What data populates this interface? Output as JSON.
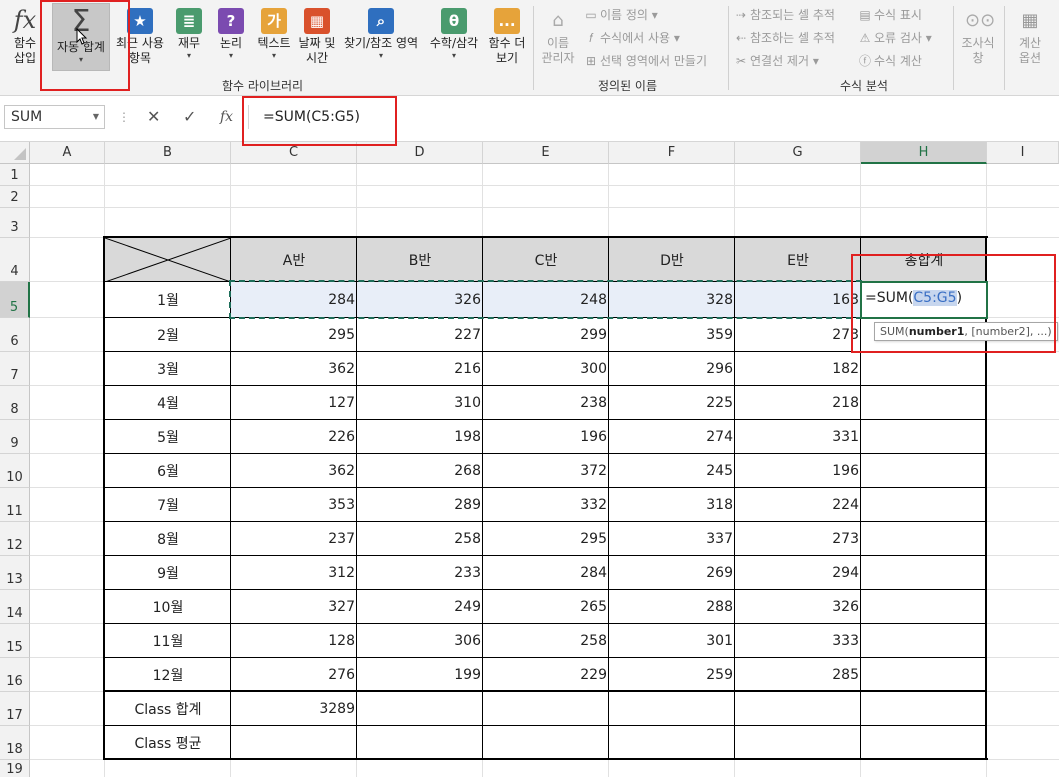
{
  "ribbon": {
    "insert_function": {
      "icon": "fx",
      "label1": "함수",
      "label2": "삽입"
    },
    "autosum": {
      "icon": "Σ",
      "label": "자동 합계",
      "arrow": "▾"
    },
    "recent": {
      "label1": "최근 사용",
      "label2": "항목",
      "arrow": "▾"
    },
    "financial": {
      "label": "재무",
      "arrow": "▾"
    },
    "logical": {
      "icon": "?",
      "label": "논리",
      "arrow": "▾"
    },
    "text": {
      "icon": "가",
      "label": "텍스트",
      "arrow": "▾"
    },
    "datetime": {
      "label1": "날짜 및",
      "label2": "시간",
      "arrow": "▾"
    },
    "lookup": {
      "label": "찾기/참조 영역",
      "arrow": "▾"
    },
    "math": {
      "icon": "θ",
      "label": "수학/삼각",
      "arrow": "▾"
    },
    "more": {
      "icon": "...",
      "label1": "함수 더",
      "label2": "보기",
      "arrow": "▾"
    },
    "name_manager": {
      "label1": "이름",
      "label2": "관리자"
    },
    "define_name": "이름 정의",
    "use_in_formula": "수식에서 사용",
    "create_from_selection": "선택 영역에서 만들기",
    "trace_precedents": "참조되는 셀 추적",
    "trace_dependents": "참조하는 셀 추적",
    "remove_arrows": "연결선 제거",
    "show_formulas": "수식 표시",
    "error_checking": "오류 검사",
    "evaluate_formula": "수식 계산",
    "watch_window": {
      "label1": "조사식",
      "label2": "창"
    },
    "calc_options": {
      "label1": "계산",
      "label2": "옵션"
    },
    "group_function_library": "함수 라이브러리",
    "group_defined_names": "정의된 이름",
    "group_formula_auditing": "수식 분석"
  },
  "formula_bar": {
    "name_box": "SUM",
    "cancel_icon": "✕",
    "enter_icon": "✓",
    "fx_icon": "fx",
    "formula": "=SUM(C5:G5)"
  },
  "columns": [
    "A",
    "B",
    "C",
    "D",
    "E",
    "F",
    "G",
    "H",
    "I"
  ],
  "rows": [
    "1",
    "2",
    "3",
    "4",
    "5",
    "6",
    "7",
    "8",
    "9",
    "10",
    "11",
    "12",
    "13",
    "14",
    "15",
    "16",
    "17",
    "18",
    "19"
  ],
  "table": {
    "headers": [
      "A반",
      "B반",
      "C반",
      "D반",
      "E반",
      "총합계"
    ],
    "months": [
      {
        "label": "1월",
        "values": [
          "284",
          "326",
          "248",
          "328",
          "163"
        ]
      },
      {
        "label": "2월",
        "values": [
          "295",
          "227",
          "299",
          "359",
          "273"
        ]
      },
      {
        "label": "3월",
        "values": [
          "362",
          "216",
          "300",
          "296",
          "182"
        ]
      },
      {
        "label": "4월",
        "values": [
          "127",
          "310",
          "238",
          "225",
          "218"
        ]
      },
      {
        "label": "5월",
        "values": [
          "226",
          "198",
          "196",
          "274",
          "331"
        ]
      },
      {
        "label": "6월",
        "values": [
          "362",
          "268",
          "372",
          "245",
          "196"
        ]
      },
      {
        "label": "7월",
        "values": [
          "353",
          "289",
          "332",
          "318",
          "224"
        ]
      },
      {
        "label": "8월",
        "values": [
          "237",
          "258",
          "295",
          "337",
          "273"
        ]
      },
      {
        "label": "9월",
        "values": [
          "312",
          "233",
          "284",
          "269",
          "294"
        ]
      },
      {
        "label": "10월",
        "values": [
          "327",
          "249",
          "265",
          "288",
          "326"
        ]
      },
      {
        "label": "11월",
        "values": [
          "128",
          "306",
          "258",
          "301",
          "333"
        ]
      },
      {
        "label": "12월",
        "values": [
          "276",
          "199",
          "229",
          "259",
          "285"
        ]
      }
    ],
    "class_total_label": "Class 합계",
    "class_total_value": "3289",
    "class_avg_label": "Class 평균"
  },
  "editing": {
    "prefix": "=SUM(",
    "ref": "C5:G5",
    "suffix": ")",
    "tooltip_fn": "SUM(",
    "tooltip_arg1": "number1",
    "tooltip_rest": ", [number2], ...)"
  }
}
